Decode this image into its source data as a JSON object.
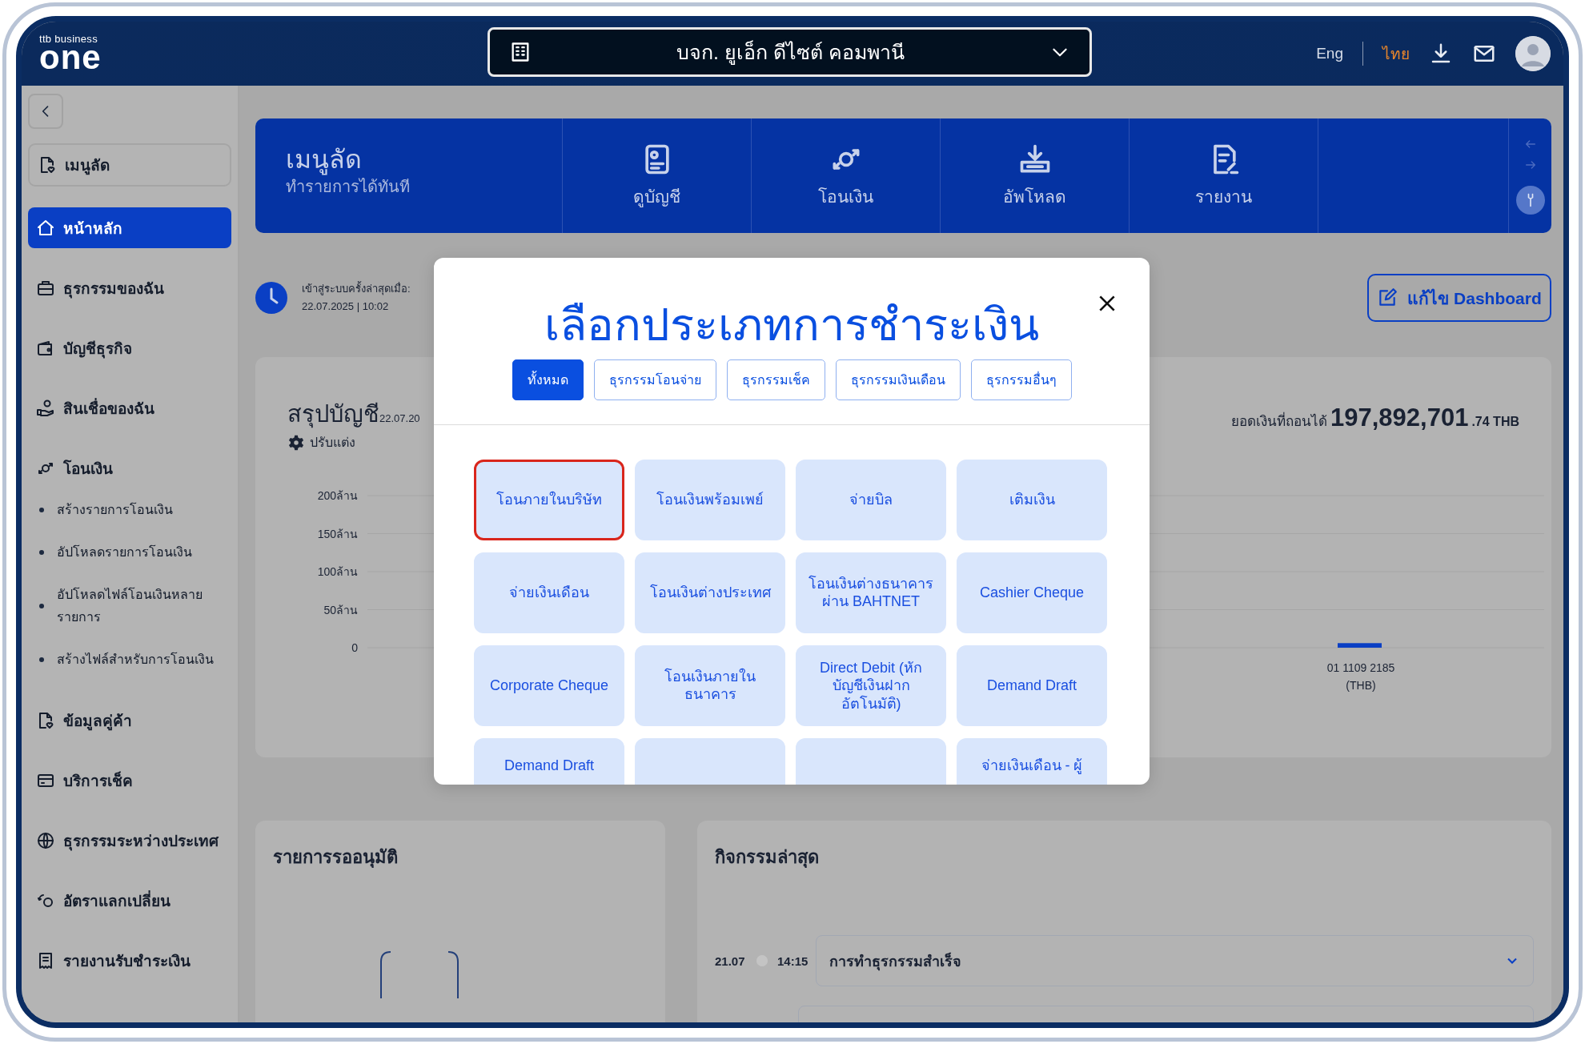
{
  "header": {
    "brand_small": "ttb business",
    "brand": "one",
    "company": "บจก. ยูเอ็ก ดีไซต์ คอมพานี",
    "languages": [
      {
        "label": "Eng",
        "selected": false
      },
      {
        "label": "ไทย",
        "selected": true
      }
    ]
  },
  "sidebar": {
    "shortcut": "เมนูลัด",
    "items": [
      {
        "kind": "home",
        "label": "หน้าหลัก",
        "selected": true
      },
      {
        "kind": "briefcase",
        "label": "ธุรกรรมของฉัน",
        "selected": false
      },
      {
        "kind": "wallet",
        "label": "บัญชีธุรกิจ",
        "selected": false
      },
      {
        "kind": "loan",
        "label": "สินเชื่อของฉัน",
        "selected": false
      },
      {
        "kind": "transfer",
        "label": "โอนเงิน",
        "selected": false,
        "children": [
          {
            "label": "สร้างรายการโอนเงิน"
          },
          {
            "label": "อัปโหลดรายการโอนเงิน"
          },
          {
            "label": "อัปโหลดไฟล์โอนเงินหลายรายการ"
          },
          {
            "label": "สร้างไฟล์สำหรับการโอนเงิน"
          }
        ]
      },
      {
        "kind": "partner",
        "label": "ข้อมูลคู่ค้า",
        "selected": false
      },
      {
        "kind": "card",
        "label": "บริการเช็ค",
        "selected": false
      },
      {
        "kind": "globe",
        "label": "ธุรกรรมระหว่างประเทศ",
        "selected": false
      },
      {
        "kind": "exchange",
        "label": "อัตราแลกเปลี่ยน",
        "selected": false
      },
      {
        "kind": "receipt",
        "label": "รายงานรับชำระเงิน",
        "selected": false
      }
    ]
  },
  "banner": {
    "title": "เมนูลัด",
    "subtitle": "ทำรายการได้ทันที",
    "shortcuts": [
      {
        "kind": "account",
        "label": "ดูบัญชี"
      },
      {
        "kind": "transfer",
        "label": "โอนเงิน"
      },
      {
        "kind": "upload",
        "label": "อัพโหลด"
      },
      {
        "kind": "report",
        "label": "รายงาน"
      }
    ]
  },
  "last_login": {
    "label": "เข้าสู่ระบบครั้งล่าสุดเมื่อ:",
    "value": "22.07.2025 | 10:02"
  },
  "edit_button": "แก้ไข Dashboard",
  "summary": {
    "title": "สรุปบัญชี",
    "date": "22.07.20",
    "customize": "ปรับแต่ง",
    "balance_label": "ยอดเงินที่ถอนได้",
    "balance": "197,892,701",
    "balance_decimals": ".74 THB",
    "chart_data": {
      "type": "bar",
      "categories": [
        "01 1109 2185 (THB)"
      ],
      "values": [
        6
      ],
      "ylim": [
        0,
        200
      ],
      "grid": true,
      "yticks": [
        {
          "value": 0,
          "label": "0"
        },
        {
          "value": 50,
          "label": "50ล้าน"
        },
        {
          "value": 100,
          "label": "100ล้าน"
        },
        {
          "value": 150,
          "label": "150ล้าน"
        },
        {
          "value": 200,
          "label": "200ล้าน"
        }
      ]
    }
  },
  "pending": {
    "title": "รายการรออนุมัติ"
  },
  "activity": {
    "title": "กิจกรรมล่าสุด",
    "entries": [
      {
        "date": "21.07",
        "time": "14:15",
        "label": "การทำธุรกรรมสำเร็จ",
        "expanded": false
      }
    ]
  },
  "modal": {
    "title": "เลือกประเภทการชำระเงิน",
    "tabs": [
      {
        "label": "ทั้งหมด",
        "selected": true
      },
      {
        "label": "ธุรกรรมโอนจ่าย",
        "selected": false
      },
      {
        "label": "ธุรกรรมเช็ค",
        "selected": false
      },
      {
        "label": "ธุรกรรมเงินเดือน",
        "selected": false
      },
      {
        "label": "ธุรกรรมอื่นๆ",
        "selected": false
      }
    ],
    "items": [
      {
        "label": "โอนภายในบริษัท",
        "selected": true
      },
      {
        "label": "โอนเงินพร้อมเพย์",
        "selected": false
      },
      {
        "label": "จ่ายบิล",
        "selected": false
      },
      {
        "label": "เติมเงิน",
        "selected": false
      },
      {
        "label": "จ่ายเงินเดือน",
        "selected": false
      },
      {
        "label": "โอนเงินต่างประเทศ",
        "selected": false
      },
      {
        "label": "โอนเงินต่างธนาคารผ่าน BAHTNET",
        "selected": false
      },
      {
        "label": "Cashier Cheque",
        "selected": false
      },
      {
        "label": "Corporate Cheque",
        "selected": false
      },
      {
        "label": "โอนเงินภายในธนาคาร",
        "selected": false
      },
      {
        "label": "Direct Debit (หักบัญชีเงินฝากอัตโนมัติ)",
        "selected": false
      },
      {
        "label": "Demand Draft",
        "selected": false
      },
      {
        "label": "Demand Draft",
        "selected": false
      },
      {
        "selected": false
      },
      {
        "selected": false
      },
      {
        "label": "จ่ายเงินเดือน - ผู้",
        "selected": false
      }
    ]
  }
}
